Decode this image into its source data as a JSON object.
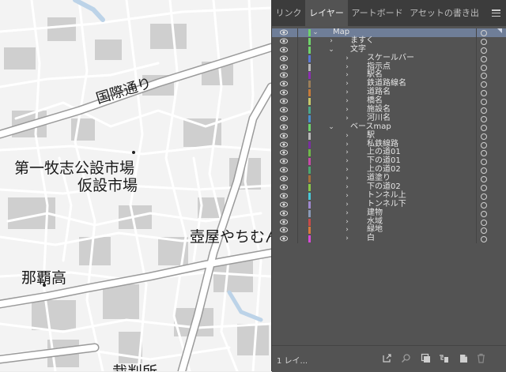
{
  "map": {
    "labels": {
      "road": "国際通り",
      "market1": "第一牧志公設市場",
      "market2": "仮設市場",
      "tsuboya": "壺屋やちむん",
      "school": "那覇高",
      "court": "裁判所"
    }
  },
  "panel": {
    "tabs": [
      "リンク",
      "レイヤー",
      "アートボード",
      "アセットの書き出"
    ],
    "active_tab": "レイヤー",
    "layers": [
      {
        "name": "Map",
        "color": "#6fd36b",
        "indent": 0,
        "arrow": "open",
        "selected": true
      },
      {
        "name": "ますく",
        "color": "#6fd36b",
        "indent": 1,
        "arrow": "closed"
      },
      {
        "name": "文字",
        "color": "#6fd36b",
        "indent": 1,
        "arrow": "open"
      },
      {
        "name": "スケールバー",
        "color": "#5a78d6",
        "indent": 2,
        "arrow": "closed"
      },
      {
        "name": "指示点",
        "color": "#b9b9b9",
        "indent": 2,
        "arrow": "closed"
      },
      {
        "name": "駅名",
        "color": "#8b2fb0",
        "indent": 2,
        "arrow": "closed"
      },
      {
        "name": "鉄道路線名",
        "color": "#9a7e5a",
        "indent": 2,
        "arrow": "closed"
      },
      {
        "name": "道路名",
        "color": "#c57a3a",
        "indent": 2,
        "arrow": "closed"
      },
      {
        "name": "橋名",
        "color": "#c8c86a",
        "indent": 2,
        "arrow": "closed"
      },
      {
        "name": "施設名",
        "color": "#4aa88a",
        "indent": 2,
        "arrow": "closed"
      },
      {
        "name": "河川名",
        "color": "#4a8fd0",
        "indent": 2,
        "arrow": "closed"
      },
      {
        "name": "ベースmap",
        "color": "#6fd36b",
        "indent": 1,
        "arrow": "open"
      },
      {
        "name": "駅",
        "color": "#b9b9b9",
        "indent": 2,
        "arrow": "closed"
      },
      {
        "name": "私鉄線路",
        "color": "#7a2fa0",
        "indent": 2,
        "arrow": "closed"
      },
      {
        "name": "上の道01",
        "color": "#6fb84a",
        "indent": 2,
        "arrow": "closed"
      },
      {
        "name": "下の道01",
        "color": "#c84aa8",
        "indent": 2,
        "arrow": "closed"
      },
      {
        "name": "上の道02",
        "color": "#4aa870",
        "indent": 2,
        "arrow": "closed"
      },
      {
        "name": "道塗り",
        "color": "#a8703a",
        "indent": 2,
        "arrow": "closed"
      },
      {
        "name": "下の道02",
        "color": "#8ac84a",
        "indent": 2,
        "arrow": "closed"
      },
      {
        "name": "トンネル上",
        "color": "#4ac8d8",
        "indent": 2,
        "arrow": "closed"
      },
      {
        "name": "トンネル下",
        "color": "#a08ad0",
        "indent": 2,
        "arrow": "closed"
      },
      {
        "name": "建物",
        "color": "#8a9ab8",
        "indent": 2,
        "arrow": "closed"
      },
      {
        "name": "水域",
        "color": "#c84a4a",
        "indent": 2,
        "arrow": "closed"
      },
      {
        "name": "緑地",
        "color": "#d87a3a",
        "indent": 2,
        "arrow": "closed"
      },
      {
        "name": "白",
        "color": "#d84ad8",
        "indent": 2,
        "arrow": "closed"
      }
    ],
    "footer": {
      "layer_count": "1 レイ...",
      "icons": [
        "export-icon",
        "search-icon",
        "clipping-mask-icon",
        "new-sublayer-icon",
        "new-layer-icon",
        "delete-icon"
      ]
    }
  }
}
